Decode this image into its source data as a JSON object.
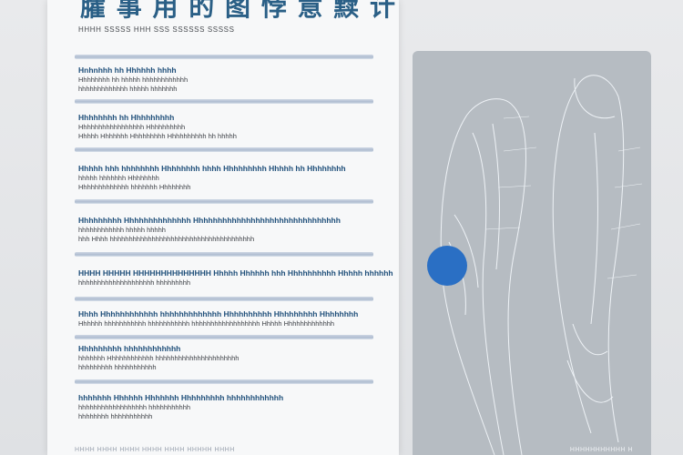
{
  "document": {
    "title": "臛 事 用 的 图 悖 意 黩 计",
    "subtitle": "HHHH SSSSS  HHH SSS SSSSSS  SSSSS",
    "sections": [
      {
        "head": "Hnhnhhh hh Hhhhhh hhhh",
        "lines": [
          "Hhhhhhhh hh hhhhh  hhhhhhhhhhhh",
          "hhhhhhhhhhhhh  hhhhh hhhhhhh"
        ]
      },
      {
        "head": "Hhhhhhhh hh Hhhhhhhhh",
        "lines": [
          "Hhhhhhhhhhhhhhhhh    Hhhhhhhhhh",
          "Hhhhh Hhhhhhh Hhhhhhhhh    Hhhhhhhhhh  hh  hhhhh"
        ]
      },
      {
        "head": "Hhhhh hhh hhhhhhhh  Hhhhhhhh  hhhh Hhhhhhhhh Hhhhh hh Hhhhhhhh",
        "lines": [
          "hhhhh hhhhhhh Hhhhhhhh",
          "Hhhhhhhhhhhhh      hhhhhhh Hhhhhhhh"
        ]
      },
      {
        "head": "Hhhhhhhhh  Hhhhhhhhhhhhhh  Hhhhhhhhhhhhhhhhhhhhhhhhhhhhhhh",
        "lines": [
          "hhhhhhhhhhhh hhhhh  hhhhh",
          "hhh Hhhh hhhhhhhhhhhhhhhhhhhhhhhhhhhhhhhhhhhhhh"
        ]
      },
      {
        "head": "HHHH HHHHH HHHHHHHHHHHHHH  Hhhhh Hhhhhh  hhh Hhhhhhhhhh Hhhhh hhhhhh",
        "lines": [
          "hhhhhhhhhhhhhhhhhhhh hhhhhhhhh"
        ]
      },
      {
        "head": "Hhhh Hhhhhhhhhhhh  hhhhhhhhhhhhh   Hhhhhhhhhh   Hhhhhhhhh Hhhhhhhh",
        "lines": [
          "Hhhhhh  hhhhhhhhhhh  hhhhhhhhhhh  hhhhhhhhhhhhhhhhhh   Hhhhh  Hhhhhhhhhhhhh"
        ]
      },
      {
        "head": "Hhhhhhhhh  hhhhhhhhhhhh",
        "lines": [
          "hhhhhhh   Hhhhhhhhhhhh  hhhhhhhhhhhhhhhhhhhhhh",
          "hhhhhhhhh hhhhhhhhhhh"
        ]
      },
      {
        "head": "hhhhhhh  Hhhhhh Hhhhhhh  Hhhhhhhhh  hhhhhhhhhhhh",
        "lines": [
          "hhhhhhhhhhhhhhhhhh  hhhhhhhhhhh",
          "hhhhhhhh hhhhhhhhhhh"
        ]
      }
    ],
    "footer": "HHHH HHHH HHHH HHHH                      HHHH HHHHH HHHH"
  },
  "illustration": {
    "caption": "HHHHHHHHHHH    H",
    "highlight_color": "#2a6fc4",
    "line_color": "#eef2f6"
  }
}
